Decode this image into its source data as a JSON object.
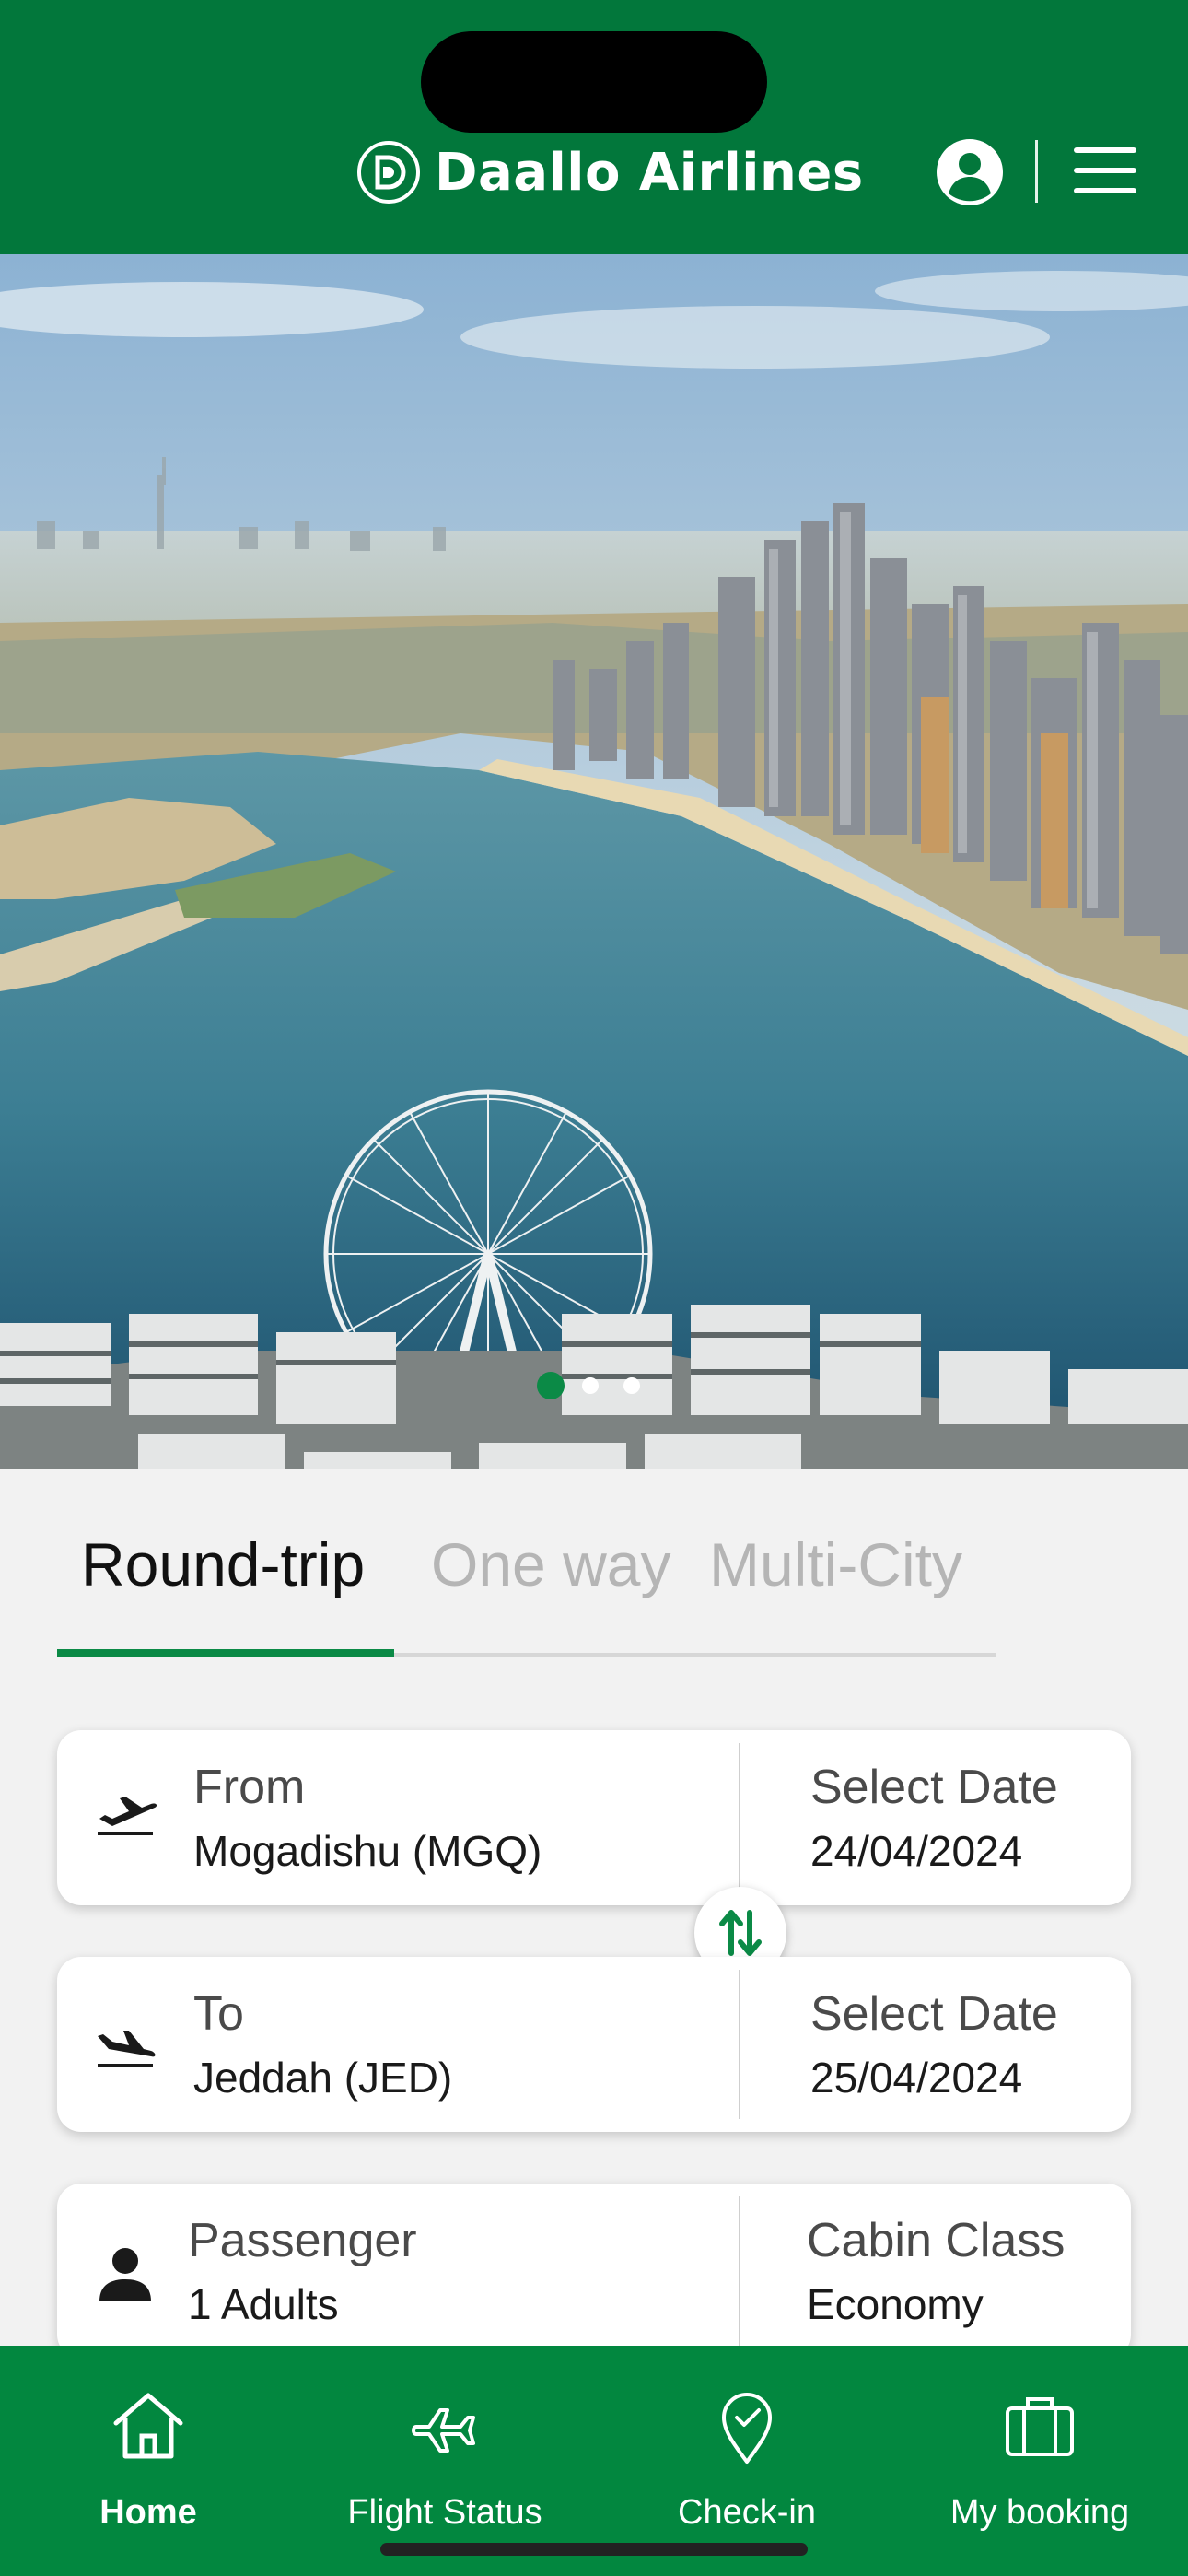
{
  "header": {
    "brand": "Daallo Airlines",
    "brand_logo_icon": "daallo-d-logo",
    "user_icon": "user-circle-icon",
    "menu_icon": "hamburger-menu-icon",
    "background_color": "#02773b"
  },
  "hero": {
    "image_description_icon": "dubai-skyline-ferris-wheel-photo",
    "carousel": {
      "total": 3,
      "active_index": 1
    }
  },
  "trip_tabs": [
    {
      "label": "Round-trip",
      "active": true
    },
    {
      "label": "One way",
      "active": false
    },
    {
      "label": "Multi-City",
      "active": false
    }
  ],
  "from_card": {
    "label": "From",
    "value": "Mogadishu (MGQ)",
    "date_label": "Select Date",
    "date_value": "24/04/2024",
    "icon": "plane-takeoff-icon"
  },
  "to_card": {
    "label": "To",
    "value": "Jeddah (JED)",
    "date_label": "Select Date",
    "date_value": "25/04/2024",
    "icon": "plane-landing-icon"
  },
  "swap_icon": "swap-arrows-icon",
  "passenger_card": {
    "label": "Passenger",
    "value": "1 Adults",
    "class_label": "Cabin Class",
    "class_value": "Economy",
    "icon": "person-icon"
  },
  "bottom_nav": [
    {
      "label": "Home",
      "icon": "home-icon",
      "active": true
    },
    {
      "label": "Flight Status",
      "icon": "airplane-icon",
      "active": false
    },
    {
      "label": "Check-in",
      "icon": "location-check-icon",
      "active": false
    },
    {
      "label": "My booking",
      "icon": "briefcase-icon",
      "active": false
    }
  ],
  "colors": {
    "brand_green": "#02773b",
    "nav_green": "#02873f",
    "accent_green": "#0b8a46"
  }
}
